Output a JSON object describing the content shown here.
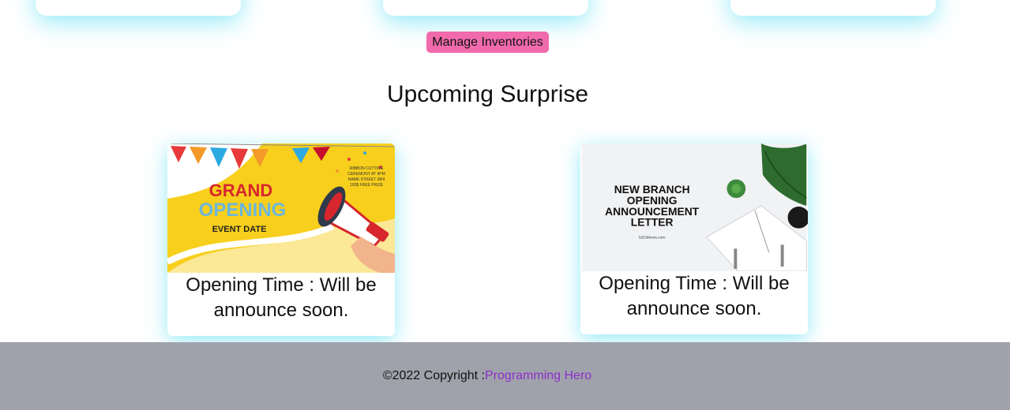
{
  "header": {
    "manage_button": "Manage Inventories"
  },
  "section": {
    "title": "Upcoming Surprise"
  },
  "cards": [
    {
      "image_text": {
        "line1": "GRAND",
        "line2": "OPENING",
        "line3": "EVENT DATE",
        "side1": "RIBBON CUTTING",
        "side2": "CEREMONY AT 9PM",
        "side3": "NAME STREET 38/4",
        "side4": "100$ FREE PRIZE"
      },
      "caption": "Opening Time : Will be announce soon."
    },
    {
      "image_text": {
        "line1": "NEW BRANCH",
        "line2": "OPENING",
        "line3": "ANNOUNCEMENT",
        "line4": "LETTER",
        "site": "52Editions.com"
      },
      "caption": "Opening Time : Will be announce soon."
    }
  ],
  "footer": {
    "copyright": "©2022 Copyright :",
    "link": "Programming Hero"
  },
  "colors": {
    "accent_button": "#f06aac",
    "glow": "#40d8f0",
    "footer_bg": "#a0a2ab",
    "link": "#8b2fc9"
  }
}
